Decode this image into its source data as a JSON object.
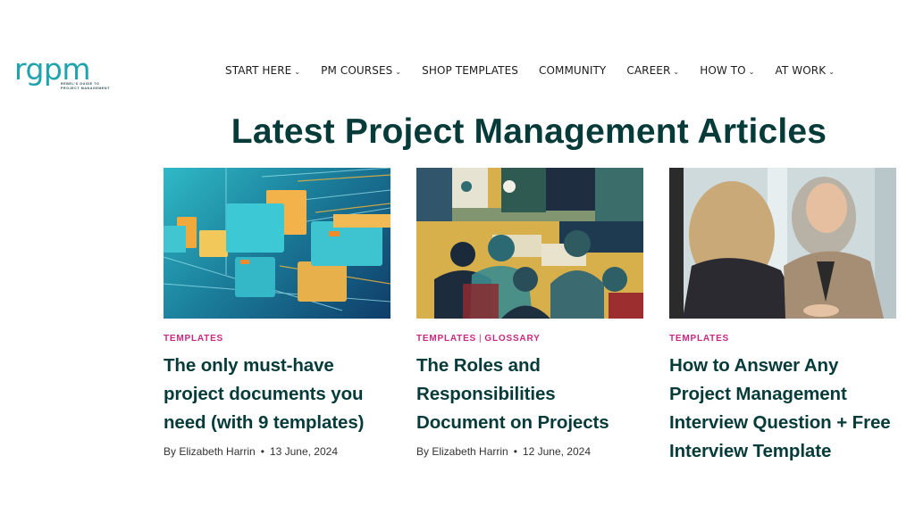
{
  "header": {
    "logo_text": "rgpm",
    "logo_tagline": "REBEL'S GUIDE TO PROJECT MANAGEMENT",
    "nav": [
      {
        "label": "START HERE",
        "has_dropdown": true
      },
      {
        "label": "PM COURSES",
        "has_dropdown": true
      },
      {
        "label": "SHOP TEMPLATES",
        "has_dropdown": false
      },
      {
        "label": "COMMUNITY",
        "has_dropdown": false
      },
      {
        "label": "CAREER",
        "has_dropdown": true
      },
      {
        "label": "HOW TO",
        "has_dropdown": true
      },
      {
        "label": "AT WORK",
        "has_dropdown": true
      }
    ]
  },
  "main": {
    "title": "Latest Project Management Articles",
    "articles": [
      {
        "image_alt": "Abstract folders flying through digital space",
        "categories": [
          "TEMPLATES"
        ],
        "title": "The only must-have project documents you need (with 9 templates)",
        "author": "By Elizabeth Harrin",
        "date": "13 June, 2024"
      },
      {
        "image_alt": "Collage of silhouettes of business people",
        "categories": [
          "TEMPLATES",
          "GLOSSARY"
        ],
        "category_separator": "|",
        "title": "The Roles and Responsibilities Document on Projects",
        "author": "By Elizabeth Harrin",
        "date": "12 June, 2024"
      },
      {
        "image_alt": "Two women talking in an interview",
        "categories": [
          "TEMPLATES"
        ],
        "title": "How to Answer Any Project Management Interview Question + Free Interview Template",
        "author": "",
        "date": ""
      }
    ],
    "meta_separator": "•"
  },
  "colors": {
    "brand_teal": "#1fa3ad",
    "heading_dark_green": "#073b3a",
    "category_pink": "#c9287e"
  }
}
